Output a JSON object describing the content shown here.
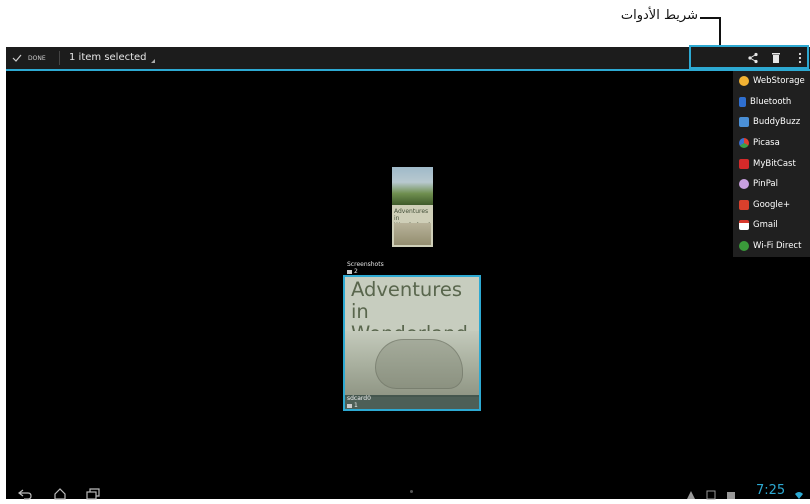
{
  "callout": {
    "label": "شريط الأدوات"
  },
  "action_bar": {
    "done_label": "DONE",
    "selection_text": "1 item selected"
  },
  "share_menu": {
    "items": [
      {
        "label": "WebStorage",
        "icon": "webstorage-icon",
        "color": "#f2b233"
      },
      {
        "label": "Bluetooth",
        "icon": "bluetooth-icon",
        "color": "#2e6fd1"
      },
      {
        "label": "BuddyBuzz",
        "icon": "buddybuzz-icon",
        "color": "#4a8fd6"
      },
      {
        "label": "Picasa",
        "icon": "picasa-icon",
        "color": "#e8e8e8"
      },
      {
        "label": "MyBitCast",
        "icon": "mybitcast-icon",
        "color": "#d42a2a"
      },
      {
        "label": "PinPal",
        "icon": "pinpal-icon",
        "color": "#c9a0e0"
      },
      {
        "label": "Google+",
        "icon": "googleplus-icon",
        "color": "#d8402c"
      },
      {
        "label": "Gmail",
        "icon": "gmail-icon",
        "color": "#d83a2e"
      },
      {
        "label": "Wi-Fi Direct",
        "icon": "wifi-direct-icon",
        "color": "#3a9a3a"
      }
    ]
  },
  "albums": {
    "screenshots": {
      "name": "Screenshots",
      "count": "2",
      "thumb_text": "Adventures in Wonderland"
    },
    "sdcard": {
      "name": "sdcard0",
      "count": "1",
      "cover_text_line1": "Adventures",
      "cover_text_line2": "in Wonderland"
    }
  },
  "status_bar": {
    "time": "7:25"
  },
  "colors": {
    "accent": "#2da9d2",
    "background": "#000000",
    "menu": "#202020"
  }
}
